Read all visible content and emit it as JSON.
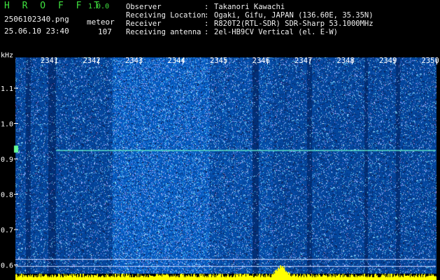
{
  "header": {
    "app_name": "H R O F F T",
    "app_version": "1.0.0",
    "file_name": "2506102340.png",
    "date_time": "25.06.10 23:40",
    "meteor_label": "meteor",
    "meteor_count": "107",
    "info": [
      {
        "key": "Observer",
        "sep": ":",
        "value": "Takanori Kawachi"
      },
      {
        "key": "Receiving Location",
        "sep": ":",
        "value": "Ogaki, Gifu, JAPAN (136.60E, 35.35N)"
      },
      {
        "key": "Receiver",
        "sep": ":",
        "value": "R820T2(RTL-SDR) SDR-Sharp 53.1000MHz"
      },
      {
        "key": "Receiving antenna",
        "sep": ":",
        "value": "2el-HB9CV Vertical (el. E-W)"
      }
    ]
  },
  "spectrogram": {
    "freq_unit": "kHz",
    "freq_ticks": [
      "1.1",
      "1.0",
      "0.9",
      "0.8",
      "0.7",
      "0.6"
    ],
    "time_ticks": [
      "2341",
      "2342",
      "2343",
      "2344",
      "2345",
      "2346",
      "2347",
      "2348",
      "2349",
      "2350"
    ],
    "colors": {
      "background": "#000000",
      "noise_dark": "#0a1a6e",
      "noise_light": "#3a7dff",
      "carrier": "#59e0c8",
      "bottom_bar": "#ffff00",
      "tick_text": "#ffffff"
    }
  }
}
